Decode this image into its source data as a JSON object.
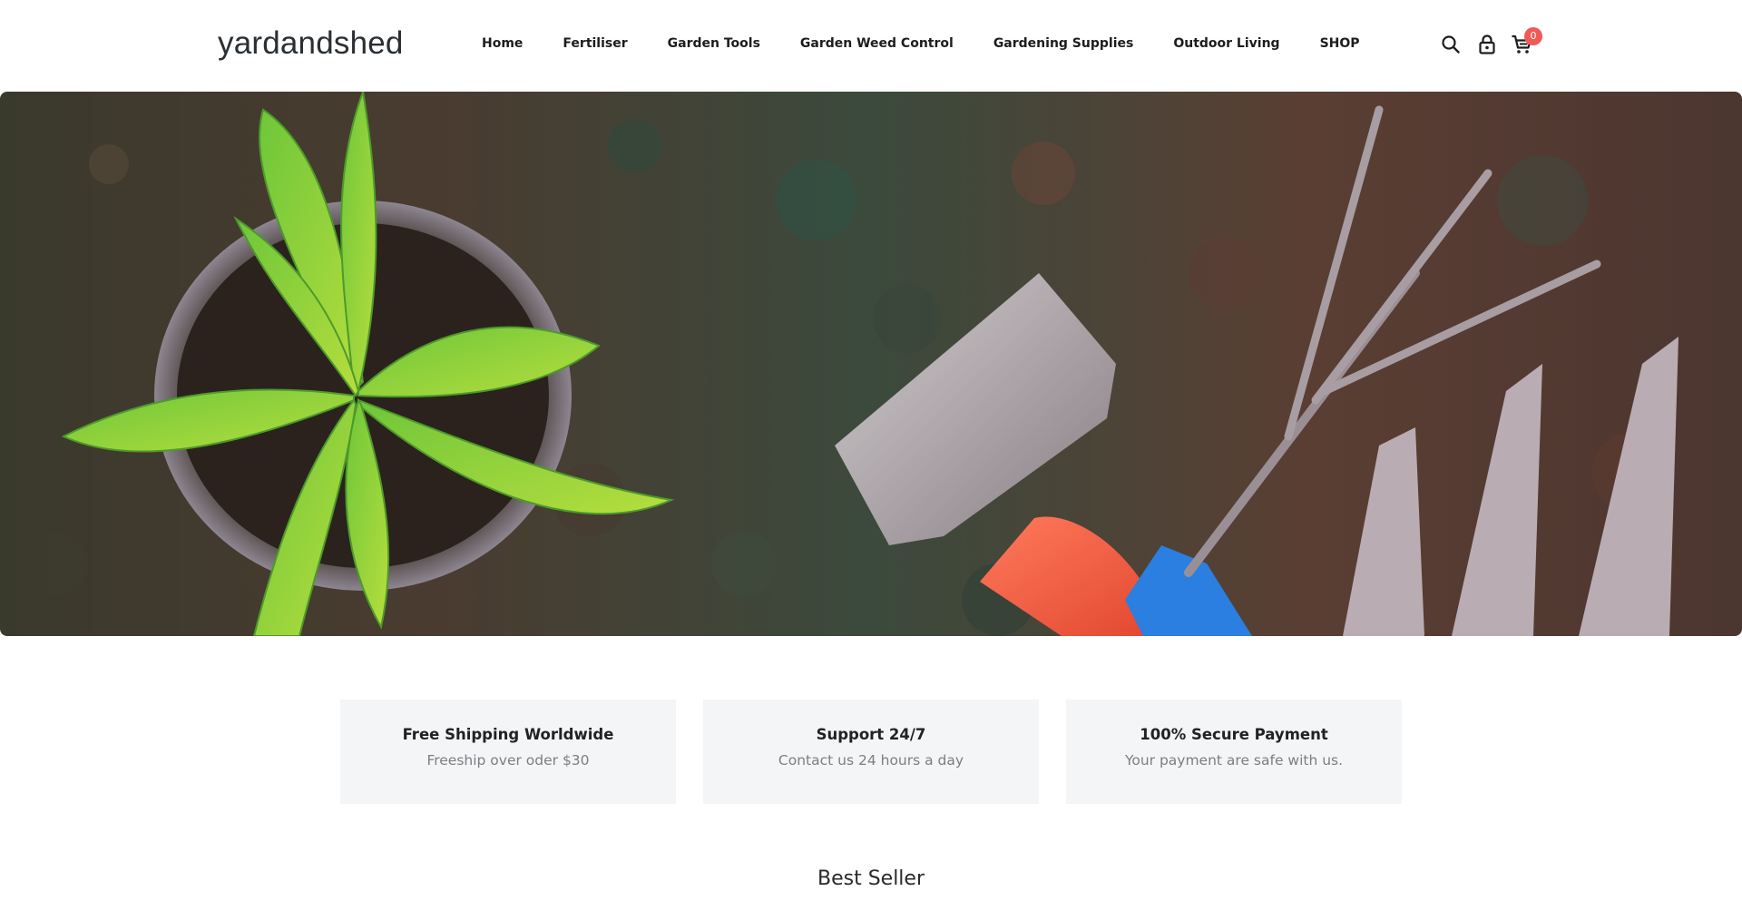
{
  "header": {
    "logo": "yardandshed",
    "nav": [
      {
        "label": "Home"
      },
      {
        "label": "Fertiliser"
      },
      {
        "label": "Garden Tools"
      },
      {
        "label": "Garden Weed Control"
      },
      {
        "label": "Gardening Supplies"
      },
      {
        "label": "Outdoor Living"
      },
      {
        "label": "SHOP"
      }
    ],
    "icons": [
      "search-icon",
      "lock-icon",
      "cart-icon"
    ],
    "cart_count": "0"
  },
  "hero": {
    "image": "potted seedling and garden trowel, fork and hand rake in soil"
  },
  "features": [
    {
      "title": "Free Shipping Worldwide",
      "subtitle": "Freeship over oder $30"
    },
    {
      "title": "Support 24/7",
      "subtitle": "Contact us 24 hours a day"
    },
    {
      "title": "100% Secure Payment",
      "subtitle": "Your payment are safe with us."
    }
  ],
  "best_seller": {
    "title": "Best Seller"
  },
  "colors": {
    "badge": "#ef5a57",
    "feature_bg": "#f4f5f6",
    "text": "#222222",
    "muted": "#7b7f83"
  }
}
